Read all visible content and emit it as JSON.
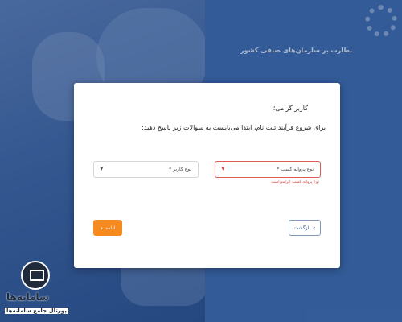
{
  "background": {
    "header_title": "نظارت بر سازمان‌های صنفی کشور"
  },
  "modal": {
    "greeting": "کاربر گرامی؛",
    "instruction": "برای شروع فرآیند ثبت نام، ابتدا می‌بایست به سوالات زیر پاسخ دهید:",
    "license_select": {
      "label": "نوع پروانه کسب *",
      "error": "نوع پروانه کسب الزامی‌است"
    },
    "user_select": {
      "label": "نوع کاربر *"
    },
    "back_label": "بازگشت",
    "next_label": "ادامه"
  },
  "watermark": {
    "name": "سامانه‌ها",
    "tagline": "پورتال جامع سامانه‌ها"
  },
  "colors": {
    "accent_orange": "#f58a1f",
    "error_red": "#d9534f",
    "back_border": "#7f99b8"
  }
}
